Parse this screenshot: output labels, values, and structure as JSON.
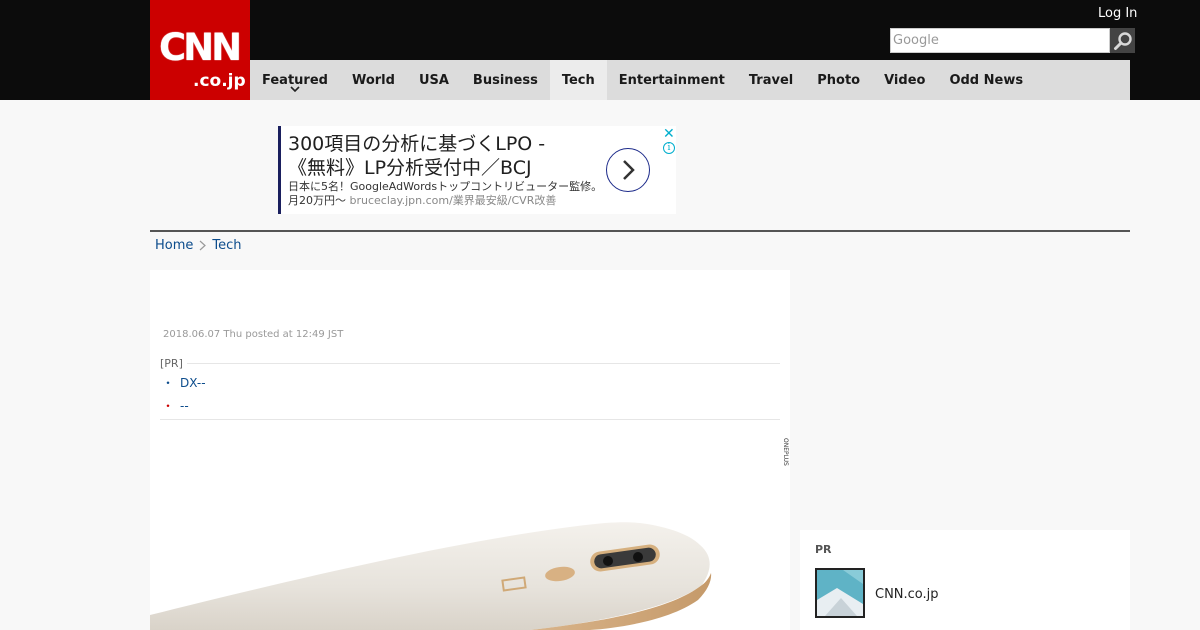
{
  "header": {
    "logo_main": "CNN",
    "logo_sub": ".co.jp",
    "login_label": "Log In",
    "search_placeholder": "Google"
  },
  "nav": {
    "items": [
      {
        "label": "Featured",
        "active": false,
        "dropdown": true
      },
      {
        "label": "World",
        "active": false
      },
      {
        "label": "USA",
        "active": false
      },
      {
        "label": "Business",
        "active": false
      },
      {
        "label": "Tech",
        "active": true
      },
      {
        "label": "Entertainment",
        "active": false
      },
      {
        "label": "Travel",
        "active": false
      },
      {
        "label": "Photo",
        "active": false
      },
      {
        "label": "Video",
        "active": false
      },
      {
        "label": "Odd News",
        "active": false
      }
    ]
  },
  "ad": {
    "headline": "300項目の分析に基づくLPO - 《無料》LP分析受付中／BCJ",
    "description": "日本に5名！GoogleAdWordsトップコントリビューター監修。月20万円〜",
    "url": "bruceclay.jpn.com/業界最安級/CVR改善"
  },
  "breadcrumb": {
    "home": "Home",
    "current": "Tech"
  },
  "article": {
    "posted": "2018.06.07 Thu posted at 12:49 JST",
    "pr_tag": "[PR]",
    "pr_links": [
      "DX--",
      "--"
    ],
    "photo_brand_text": "ONEPLUS"
  },
  "sidebar": {
    "pr_title": "PR",
    "pr_item_label": "CNN.co.jp"
  },
  "colors": {
    "brand_red": "#cc0000",
    "header_black": "#0c0c0c",
    "nav_bg": "#dcdcdc",
    "link_blue": "#0c4c8c"
  }
}
